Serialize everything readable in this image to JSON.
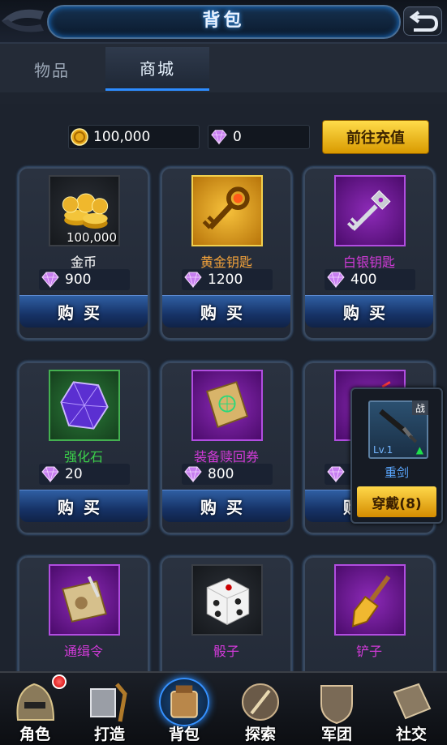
{
  "header": {
    "title": "背包"
  },
  "tabs": [
    {
      "label": "物品"
    },
    {
      "label": "商城"
    }
  ],
  "balance": {
    "gold": "100,000",
    "gems": "0",
    "topup_label": "前往充值"
  },
  "shop_items": [
    {
      "name": "金币",
      "qty": "100,000",
      "price": "900",
      "name_color": "#ffffff",
      "icon": "gold-coins-icon"
    },
    {
      "name": "黄金钥匙",
      "price": "1200",
      "name_color": "#f2a23a",
      "icon": "golden-key-icon"
    },
    {
      "name": "白银钥匙",
      "price": "400",
      "name_color": "#d13ad8",
      "icon": "silver-key-icon"
    },
    {
      "name": "强化石",
      "price": "20",
      "name_color": "#3bd14a",
      "icon": "purple-gem-icon"
    },
    {
      "name": "装备赎回券",
      "price": "800",
      "name_color": "#d13ad8",
      "icon": "scroll-icon"
    },
    {
      "name": "",
      "price": "",
      "name_color": "#d13ad8",
      "icon": "hidden-item-icon"
    },
    {
      "name": "通缉令",
      "name_color": "#d13ad8",
      "icon": "wanted-poster-icon"
    },
    {
      "name": "骰子",
      "name_color": "#d13ad8",
      "icon": "dice-icon"
    },
    {
      "name": "铲子",
      "name_color": "#d13ad8",
      "icon": "shovel-icon"
    }
  ],
  "buy_label": "购买",
  "popup": {
    "tag": "战",
    "level": "Lv.1",
    "name": "重剑",
    "button": "穿戴(8)"
  },
  "navbar": [
    {
      "label": "角色",
      "icon": "helmet-icon"
    },
    {
      "label": "打造",
      "icon": "anvil-icon"
    },
    {
      "label": "背包",
      "icon": "backpack-icon"
    },
    {
      "label": "探索",
      "icon": "explore-icon"
    },
    {
      "label": "军团",
      "icon": "shield-icon"
    },
    {
      "label": "社交",
      "icon": "social-icon"
    }
  ]
}
